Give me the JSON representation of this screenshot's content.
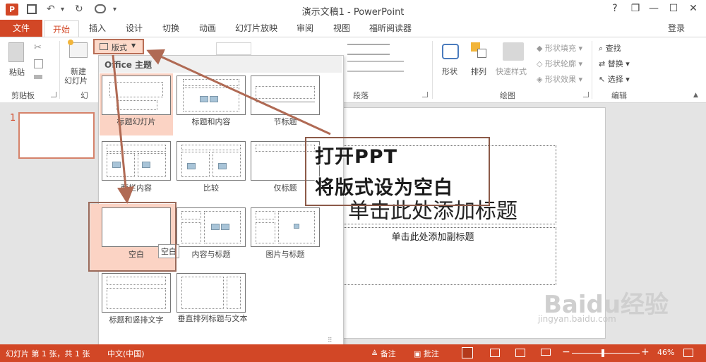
{
  "app": {
    "title": "演示文稿1 - PowerPoint",
    "help_btn": "?",
    "restore_btn": "❐",
    "minimize_btn": "—",
    "maximize_btn": "☐",
    "close_btn": "✕",
    "login": "登录"
  },
  "quick_access": {
    "undo": "↶",
    "undo_arrow": "▾",
    "redo": "↻",
    "customize": "▾"
  },
  "tabs": [
    "文件",
    "开始",
    "插入",
    "设计",
    "切换",
    "动画",
    "幻灯片放映",
    "审阅",
    "视图",
    "福昕阅读器"
  ],
  "ribbon": {
    "clipboard": {
      "paste": "粘贴",
      "group": "剪贴板"
    },
    "slides": {
      "new_slide_line1": "新建",
      "new_slide_line2": "幻灯片",
      "layout": "版式",
      "group": "幻"
    },
    "paragraph": {
      "group": "段落"
    },
    "drawing": {
      "shapes": "形状",
      "arrange": "排列",
      "quick_styles": "快速样式",
      "fill": "形状填充",
      "outline": "形状轮廓",
      "effects": "形状效果",
      "group": "绘图"
    },
    "editing": {
      "find": "查找",
      "replace": "替换",
      "select": "选择",
      "group": "编辑"
    }
  },
  "thumbnails": {
    "slide_number": "1"
  },
  "gallery": {
    "header": "Office 主题",
    "layouts": [
      "标题幻灯片",
      "标题和内容",
      "节标题",
      "两栏内容",
      "比较",
      "仅标题",
      "空白",
      "内容与标题",
      "图片与标题",
      "标题和竖排文字",
      "垂直排列标题与文本"
    ],
    "selected": "标题幻灯片",
    "tooltip": "空白"
  },
  "slide": {
    "title_placeholder": "单击此处添加标题",
    "subtitle_placeholder": "单击此处添加副标题"
  },
  "annotation": {
    "line1": "打开PPT",
    "line2": "将版式设为空白"
  },
  "status": {
    "slide_info": "幻灯片 第 1 张，共 1 张",
    "language": "中文(中国)",
    "notes": "备注",
    "comments": "批注",
    "zoom": "46%"
  },
  "watermark": {
    "text": "Baidu经验",
    "url": "jingyan.baidu.com"
  },
  "colors": {
    "accent": "#d24726",
    "highlight": "#fbd3c4",
    "annotation_border": "#8c5a48"
  }
}
